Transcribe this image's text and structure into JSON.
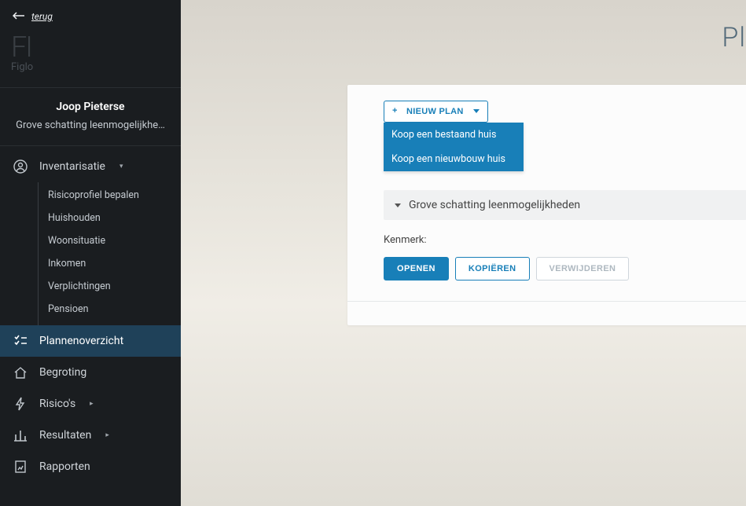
{
  "back_link": "terug",
  "logo": {
    "mark": "FI",
    "sub": "Figlo"
  },
  "client": {
    "name": "Joop Pieterse",
    "project": "Grove schatting leenmogelijkhe…"
  },
  "page_title": "Pl",
  "nav": {
    "inventarisatie": {
      "label": "Inventarisatie",
      "items": [
        "Risicoprofiel bepalen",
        "Huishouden",
        "Woonsituatie",
        "Inkomen",
        "Verplichtingen",
        "Pensioen"
      ]
    },
    "plannenoverzicht": "Plannenoverzicht",
    "begroting": "Begroting",
    "risicos": "Risico's",
    "resultaten": "Resultaten",
    "rapporten": "Rapporten"
  },
  "panel": {
    "new_plan_btn": "NIEUW PLAN",
    "dropdown": {
      "item1": "Koop een bestaand huis",
      "item2": "Koop een nieuwbouw huis"
    },
    "plan_title": "Grove schatting leenmogelijkheden",
    "kenmerk_label": "Kenmerk:",
    "open": "OPENEN",
    "copy": "KOPIËREN",
    "delete": "VERWIJDEREN"
  }
}
